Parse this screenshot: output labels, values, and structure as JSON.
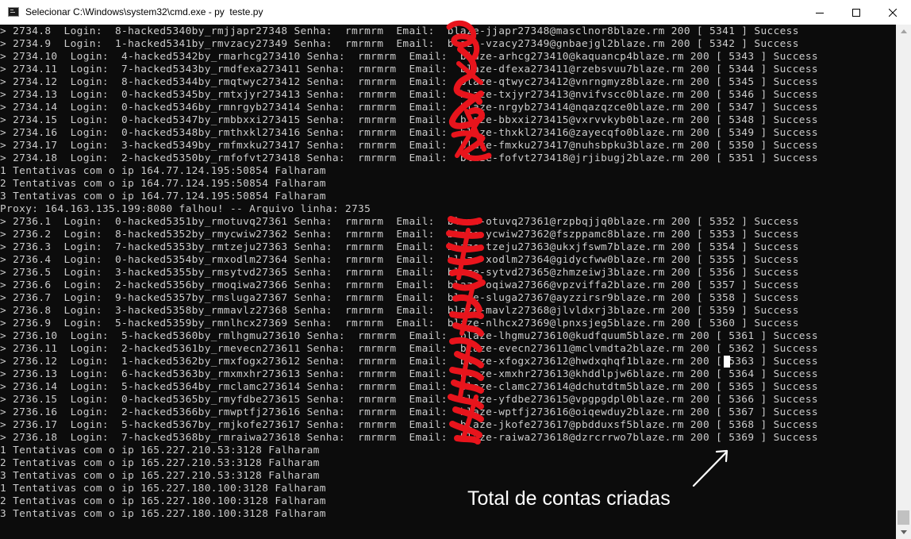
{
  "window": {
    "title": "Selecionar C:\\Windows\\system32\\cmd.exe - py  teste.py",
    "icon": "cmd-console-icon",
    "controls": [
      "minimize-icon",
      "maximize-icon",
      "close-icon"
    ]
  },
  "terminal": {
    "lines": [
      "> 2734.8  Login:  8-hacked5340by_rmjjapr27348 Senha:  rmrmrm  Email:  blaze-jjapr27348@masclnor8blaze.rm 200 [ 5341 ] Success",
      "> 2734.9  Login:  1-hacked5341by_rmvzacy27349 Senha:  rmrmrm  Email:  blaze-vzacy27349@gnbaejgl2blaze.rm 200 [ 5342 ] Success",
      "> 2734.10  Login:  4-hacked5342by_rmarhcg273410 Senha:  rmrmrm  Email:  blaze-arhcg273410@kaquancp4blaze.rm 200 [ 5343 ] Success",
      "> 2734.11  Login:  7-hacked5343by_rmdfexa273411 Senha:  rmrmrm  Email:  blaze-dfexa273411@rzebsvuu7blaze.rm 200 [ 5344 ] Success",
      "> 2734.12  Login:  8-hacked5344by_rmqtwyc273412 Senha:  rmrmrm  Email:  blaze-qtwyc273412@vnrngmyz8blaze.rm 200 [ 5345 ] Success",
      "> 2734.13  Login:  0-hacked5345by_rmtxjyr273413 Senha:  rmrmrm  Email:  blaze-txjyr273413@nvifvscc0blaze.rm 200 [ 5346 ] Success",
      "> 2734.14  Login:  0-hacked5346by_rmnrgyb273414 Senha:  rmrmrm  Email:  blaze-nrgyb273414@nqazqzce0blaze.rm 200 [ 5347 ] Success",
      "> 2734.15  Login:  0-hacked5347by_rmbbxxi273415 Senha:  rmrmrm  Email:  blaze-bbxxi273415@vxrvvkyb0blaze.rm 200 [ 5348 ] Success",
      "> 2734.16  Login:  0-hacked5348by_rmthxkl273416 Senha:  rmrmrm  Email:  blaze-thxkl273416@zayecqfo0blaze.rm 200 [ 5349 ] Success",
      "> 2734.17  Login:  3-hacked5349by_rmfmxku273417 Senha:  rmrmrm  Email:  blaze-fmxku273417@nuhsbpku3blaze.rm 200 [ 5350 ] Success",
      "> 2734.18  Login:  2-hacked5350by_rmfofvt273418 Senha:  rmrmrm  Email:  blaze-fofvt273418@jrjibugj2blaze.rm 200 [ 5351 ] Success",
      "1 Tentativas com o ip 164.77.124.195:50854 Falharam",
      "2 Tentativas com o ip 164.77.124.195:50854 Falharam",
      "3 Tentativas com o ip 164.77.124.195:50854 Falharam",
      "Proxy: 164.163.135.199:8080 falhou! -- Arquivo linha: 2735",
      "> 2736.1  Login:  0-hacked5351by_rmotuvq27361 Senha:  rmrmrm  Email:  blaze-otuvq27361@rzpbqjjq0blaze.rm 200 [ 5352 ] Success",
      "> 2736.2  Login:  8-hacked5352by_rmycwiw27362 Senha:  rmrmrm  Email:  blaze-ycwiw27362@fszppamc8blaze.rm 200 [ 5353 ] Success",
      "> 2736.3  Login:  7-hacked5353by_rmtzeju27363 Senha:  rmrmrm  Email:  blaze-tzeju27363@ukxjfswm7blaze.rm 200 [ 5354 ] Success",
      "> 2736.4  Login:  0-hacked5354by_rmxodlm27364 Senha:  rmrmrm  Email:  blaze-xodlm27364@gidycfww0blaze.rm 200 [ 5355 ] Success",
      "> 2736.5  Login:  3-hacked5355by_rmsytvd27365 Senha:  rmrmrm  Email:  blaze-sytvd27365@zhmzeiwj3blaze.rm 200 [ 5356 ] Success",
      "> 2736.6  Login:  2-hacked5356by_rmoqiwa27366 Senha:  rmrmrm  Email:  blaze-oqiwa27366@vpzviffa2blaze.rm 200 [ 5357 ] Success",
      "> 2736.7  Login:  9-hacked5357by_rmsluga27367 Senha:  rmrmrm  Email:  blaze-sluga27367@ayzzirsr9blaze.rm 200 [ 5358 ] Success",
      "> 2736.8  Login:  3-hacked5358by_rmmavlz27368 Senha:  rmrmrm  Email:  blaze-mavlz27368@jlvldxrj3blaze.rm 200 [ 5359 ] Success",
      "> 2736.9  Login:  5-hacked5359by_rmnlhcx27369 Senha:  rmrmrm  Email:  blaze-nlhcx27369@lpnxsjeg5blaze.rm 200 [ 5360 ] Success",
      "> 2736.10  Login:  5-hacked5360by_rmlhgmu273610 Senha:  rmrmrm  Email:  blaze-lhgmu273610@kudfquum5blaze.rm 200 [ 5361 ] Success",
      "> 2736.11  Login:  2-hacked5361by_rmevecn273611 Senha:  rmrmrm  Email:  blaze-evecn273611@mclvmdta2blaze.rm 200 [ 5362 ] Success",
      "> 2736.12  Login:  1-hacked5362by_rmxfogx273612 Senha:  rmrmrm  Email:  blaze-xfogx273612@hwdxqhqf1blaze.rm 200 [ 5363 ] Success",
      "> 2736.13  Login:  6-hacked5363by_rmxmxhr273613 Senha:  rmrmrm  Email:  blaze-xmxhr273613@khddlpjw6blaze.rm 200 [ 5364 ] Success",
      "> 2736.14  Login:  5-hacked5364by_rmclamc273614 Senha:  rmrmrm  Email:  blaze-clamc273614@dchutdtm5blaze.rm 200 [ 5365 ] Success",
      "> 2736.15  Login:  0-hacked5365by_rmyfdbe273615 Senha:  rmrmrm  Email:  blaze-yfdbe273615@vpgpgdpl0blaze.rm 200 [ 5366 ] Success",
      "> 2736.16  Login:  2-hacked5366by_rmwptfj273616 Senha:  rmrmrm  Email:  blaze-wptfj273616@oiqewduy2blaze.rm 200 [ 5367 ] Success",
      "> 2736.17  Login:  5-hacked5367by_rmjkofe273617 Senha:  rmrmrm  Email:  blaze-jkofe273617@pbdduxsf5blaze.rm 200 [ 5368 ] Success",
      "> 2736.18  Login:  7-hacked5368by_rmraiwa273618 Senha:  rmrmrm  Email:  blaze-raiwa273618@dzrcrrwo7blaze.rm 200 [ 5369 ] Success",
      "1 Tentativas com o ip 165.227.210.53:3128 Falharam",
      "2 Tentativas com o ip 165.227.210.53:3128 Falharam",
      "3 Tentativas com o ip 165.227.210.53:3128 Falharam",
      "1 Tentativas com o ip 165.227.180.100:3128 Falharam",
      "2 Tentativas com o ip 165.227.180.100:3128 Falharam",
      "3 Tentativas com o ip 165.227.180.100:3128 Falharam"
    ]
  },
  "annotation": {
    "text": "Total de contas criadas",
    "arrow_color": "#ffffff"
  },
  "colors": {
    "terminal_bg": "#0c0c0c",
    "terminal_text": "#cccccc",
    "scribble": "#e8141c",
    "titlebar_bg": "#ffffff"
  }
}
